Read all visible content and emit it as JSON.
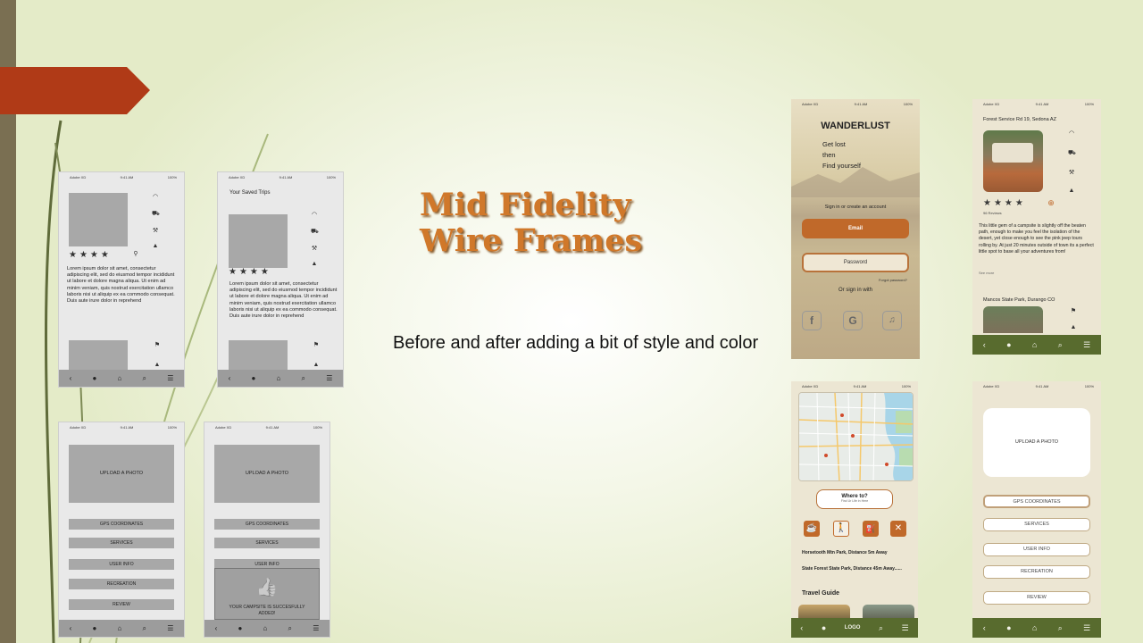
{
  "slide": {
    "title_line1": "Mid Fidelity",
    "title_line2": "Wire Frames",
    "caption": "Before and after adding a bit of style and color",
    "colors": {
      "accent_red": "#b03a17",
      "title_orange": "#d0782a",
      "nav_green": "#586b2e",
      "button_orange": "#c0692a"
    }
  },
  "status_bar": {
    "carrier": "Adobe XD",
    "time": "9:41 AM",
    "battery": "100%"
  },
  "wireframes": {
    "saved_trips_title": "Your Saved Trips",
    "lorem": "Lorem ipsum dolor sit amet, consectetur adipiscing elit, sed do eiusmod tempor incididunt ut labore et dolore magna aliqua. Ut enim ad minim veniam, quis nostrud exercitation ullamco laboris nisi ut aliquip ex ea commodo consequat. Duis aute irure dolor in reprehend",
    "upload_photo": "UPLOAD A PHOTO",
    "gps": "GPS COORDINATES",
    "services": "SERVICES",
    "user_info": "USER INFO",
    "recreation": "RECREATION",
    "review": "REVIEW",
    "success_message": "YOUR CAMPSITE IS SUCCESFULLY ADDED!"
  },
  "login": {
    "brand": "WANDERLUST",
    "tagline1": "Get lost",
    "tagline2": "then",
    "tagline3": "Find yourself",
    "sign_in_label": "Sign in or create an account",
    "email_button": "Email",
    "password_button": "Password",
    "forgot": "Forgot password?",
    "or_sign_in": "Or sign in with"
  },
  "detail": {
    "location": "Forest Service Rd 19, Sedona AZ",
    "reviews": "96 Reviews",
    "description": "This little gem of a campsite is slightly off the beaten path, enough to make you feel the isolation of the desert, yet close enough to see the pink jeep tours rolling by. At just 20 minutes outside of town its a perfect little spot to base all your adventures from!",
    "see_more": "See more",
    "location2": "Mancos State Park, Durango CO"
  },
  "map_screen": {
    "where_to": "Where to?",
    "where_sub": "Find Ur Life in Here",
    "park1": "Horsetooth Mtn Park,  Distance 5m Away",
    "park2": "State Forest State Park, Distance 45m Away......",
    "travel_guide": "Travel Guide",
    "logo": "LOGO"
  },
  "styled_upload": {
    "upload_photo": "UPLOAD A PHOTO",
    "gps": "GPS COORDINATES",
    "services": "SERVICES",
    "user_info": "USER INFO",
    "recreation": "RECREATION",
    "review": "REVIEW"
  },
  "icons": {
    "back": "‹",
    "user": "●",
    "home": "⌂",
    "search": "⌕",
    "menu": "☰",
    "wifi": "◠",
    "cart": "⛟",
    "wrench": "⚒",
    "tent": "▲",
    "pin": "⚲",
    "flag": "⚑",
    "plus": "⊕",
    "thumb": "👍"
  }
}
